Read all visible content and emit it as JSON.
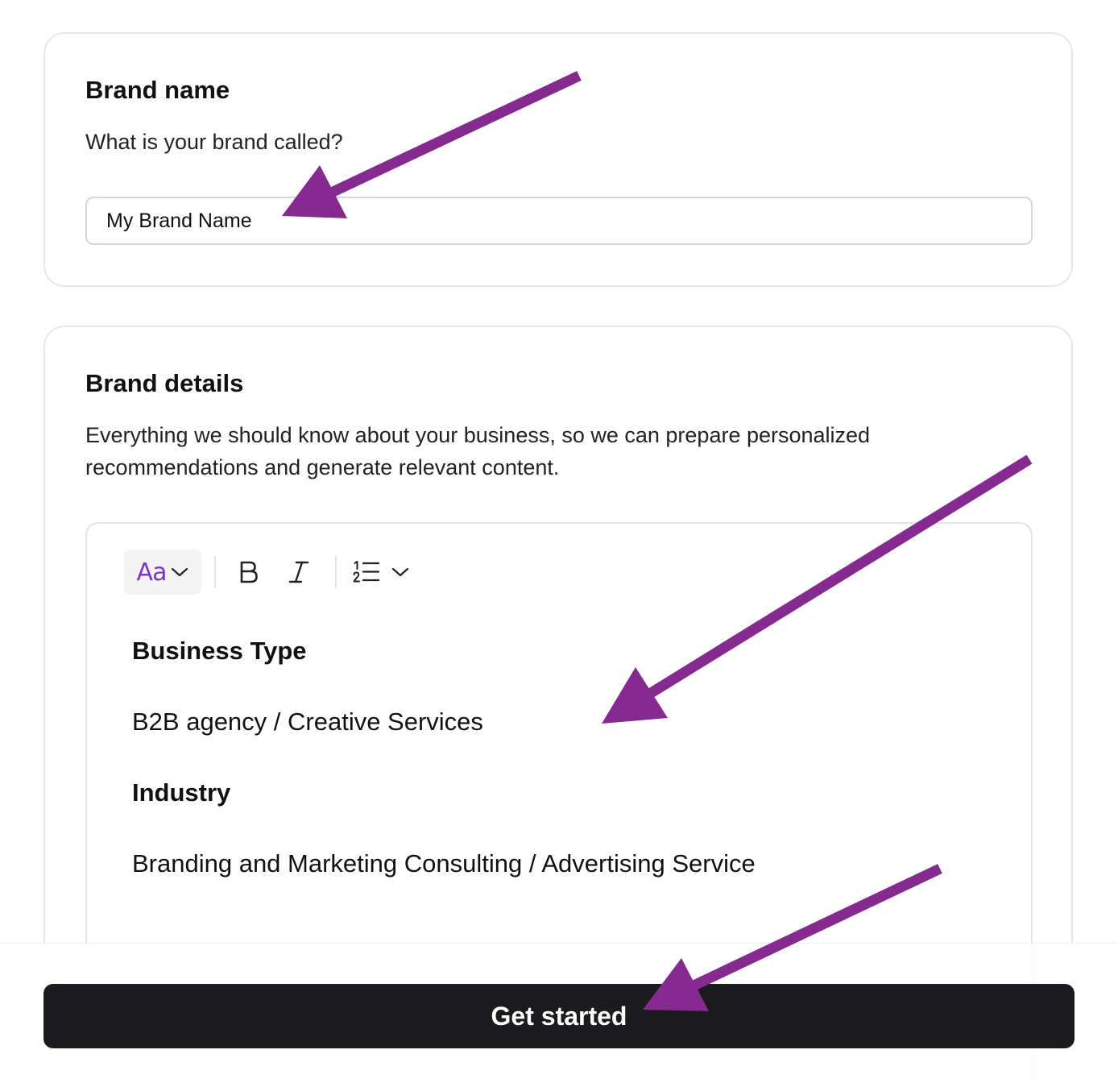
{
  "brand_name": {
    "title": "Brand name",
    "description": "What is your brand called?",
    "input_value": "My Brand Name"
  },
  "brand_details": {
    "title": "Brand details",
    "description": "Everything we should know about your business, so we can prepare personalized recommendations and generate relevant content.",
    "toolbar": {
      "font_label": "Aa",
      "font_icon": "text-style-icon",
      "bold_icon": "bold-icon",
      "italic_icon": "italic-icon",
      "list_icon": "numbered-list-icon"
    },
    "content": [
      {
        "type": "heading",
        "text": "Business Type"
      },
      {
        "type": "paragraph",
        "text": "B2B agency / Creative Services"
      },
      {
        "type": "heading",
        "text": "Industry"
      },
      {
        "type": "paragraph",
        "text": "Branding and Marketing Consulting / Advertising Service"
      }
    ]
  },
  "footer": {
    "cta_label": "Get started"
  },
  "colors": {
    "accent": "#7b35c9",
    "annotation_arrow": "#852a8f",
    "cta_background": "#1b1b1d"
  }
}
